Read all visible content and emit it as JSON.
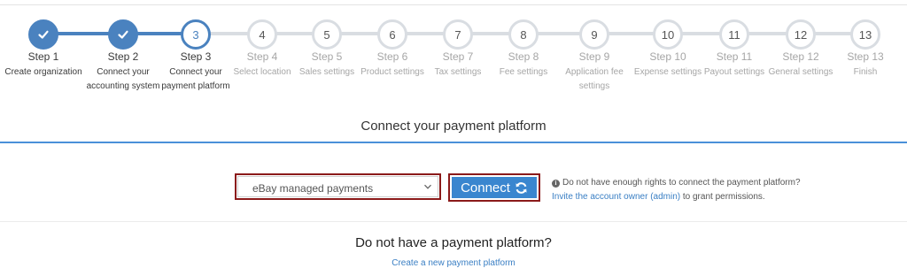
{
  "colors": {
    "accent": "#4a82bf",
    "inactive_border": "#d9dde2",
    "highlight_border": "#8b1a1a",
    "connect_button": "#3a86cf",
    "section_rule": "#4a90d9",
    "link": "#3a7fc4"
  },
  "steps": [
    {
      "title": "Step 1",
      "desc": "Create organization",
      "state": "done"
    },
    {
      "title": "Step 2",
      "desc": "Connect your accounting system",
      "state": "done"
    },
    {
      "title": "Step 3",
      "desc": "Connect your payment platform",
      "state": "current",
      "number": "3"
    },
    {
      "title": "Step 4",
      "desc": "Select location",
      "state": "todo",
      "number": "4"
    },
    {
      "title": "Step 5",
      "desc": "Sales settings",
      "state": "todo",
      "number": "5"
    },
    {
      "title": "Step 6",
      "desc": "Product settings",
      "state": "todo",
      "number": "6"
    },
    {
      "title": "Step 7",
      "desc": "Tax settings",
      "state": "todo",
      "number": "7"
    },
    {
      "title": "Step 8",
      "desc": "Fee settings",
      "state": "todo",
      "number": "8"
    },
    {
      "title": "Step 9",
      "desc": "Application fee settings",
      "state": "todo",
      "number": "9"
    },
    {
      "title": "Step 10",
      "desc": "Expense settings",
      "state": "todo",
      "number": "10"
    },
    {
      "title": "Step 11",
      "desc": "Payout settings",
      "state": "todo",
      "number": "11"
    },
    {
      "title": "Step 12",
      "desc": "General settings",
      "state": "todo",
      "number": "12"
    },
    {
      "title": "Step 13",
      "desc": "Finish",
      "state": "todo",
      "number": "13"
    }
  ],
  "section": {
    "title": "Connect your payment platform"
  },
  "platform_select": {
    "selected": "eBay managed payments",
    "icon": "chevron-down-icon"
  },
  "connect_button": {
    "label": "Connect",
    "icon": "refresh-icon"
  },
  "rights_notice": {
    "icon": "info-icon",
    "text": "Do not have enough rights to connect the payment platform?",
    "invite_link": "Invite the account owner",
    "admin_link": "(admin)",
    "suffix": "to grant permissions."
  },
  "no_platform": {
    "title": "Do not have a payment platform?",
    "create_link": "Create a new payment platform"
  }
}
